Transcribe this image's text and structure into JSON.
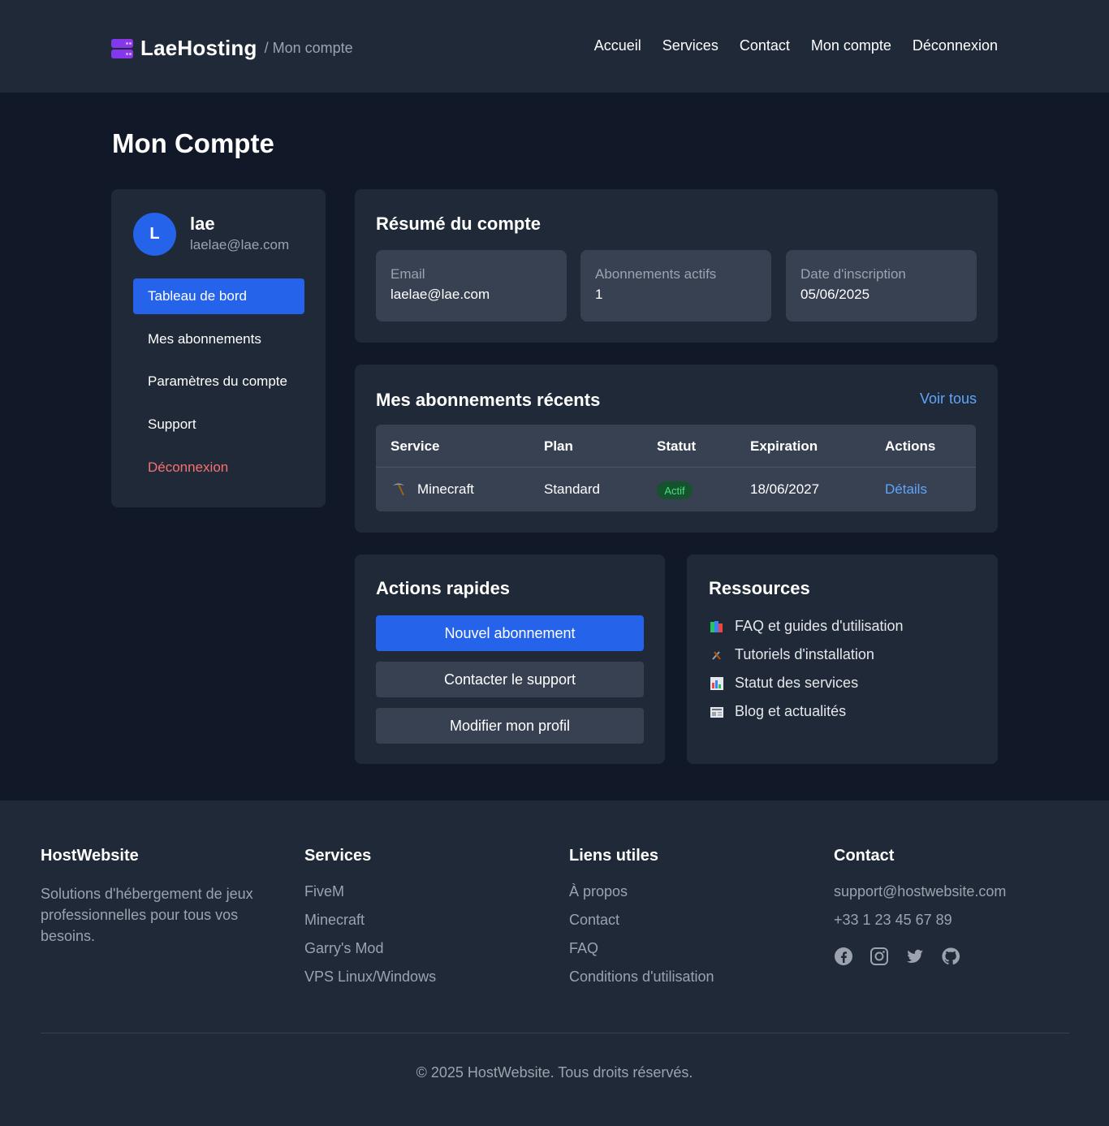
{
  "header": {
    "brand": "LaeHosting",
    "breadcrumb": "/ Mon compte",
    "nav": [
      "Accueil",
      "Services",
      "Contact",
      "Mon compte",
      "Déconnexion"
    ]
  },
  "page_title": "Mon Compte",
  "user": {
    "initial": "L",
    "name": "lae",
    "email": "laelae@lae.com"
  },
  "sidebar": {
    "items": [
      "Tableau de bord",
      "Mes abonnements",
      "Paramètres du compte",
      "Support",
      "Déconnexion"
    ]
  },
  "summary": {
    "title": "Résumé du compte",
    "stats": [
      {
        "label": "Email",
        "value": "laelae@lae.com"
      },
      {
        "label": "Abonnements actifs",
        "value": "1"
      },
      {
        "label": "Date d'inscription",
        "value": "05/06/2025"
      }
    ]
  },
  "subscriptions": {
    "title": "Mes abonnements récents",
    "see_all": "Voir tous",
    "columns": [
      "Service",
      "Plan",
      "Statut",
      "Expiration",
      "Actions"
    ],
    "rows": [
      {
        "service": "Minecraft",
        "plan": "Standard",
        "status": "Actif",
        "expiration": "18/06/2027",
        "action": "Détails"
      }
    ]
  },
  "quick_actions": {
    "title": "Actions rapides",
    "buttons": [
      "Nouvel abonnement",
      "Contacter le support",
      "Modifier mon profil"
    ]
  },
  "resources": {
    "title": "Ressources",
    "items": [
      {
        "icon": "books-icon",
        "label": "FAQ et guides d'utilisation"
      },
      {
        "icon": "tools-icon",
        "label": "Tutoriels d'installation"
      },
      {
        "icon": "chart-icon",
        "label": "Statut des services"
      },
      {
        "icon": "newspaper-icon",
        "label": "Blog et actualités"
      }
    ]
  },
  "footer": {
    "brand": {
      "title": "HostWebsite",
      "description": "Solutions d'hébergement de jeux professionnelles pour tous vos besoins."
    },
    "services": {
      "title": "Services",
      "links": [
        "FiveM",
        "Minecraft",
        "Garry's Mod",
        "VPS Linux/Windows"
      ]
    },
    "links": {
      "title": "Liens utiles",
      "links": [
        "À propos",
        "Contact",
        "FAQ",
        "Conditions d'utilisation"
      ]
    },
    "contact": {
      "title": "Contact",
      "email": "support@hostwebsite.com",
      "phone": "+33 1 23 45 67 89",
      "social": [
        "facebook-icon",
        "instagram-icon",
        "twitter-icon",
        "github-icon"
      ]
    },
    "copyright": "© 2025 HostWebsite. Tous droits réservés."
  },
  "colors": {
    "accent": "#2563eb",
    "danger": "#f87171",
    "link": "#60a5fa",
    "success": "#4ade80"
  }
}
